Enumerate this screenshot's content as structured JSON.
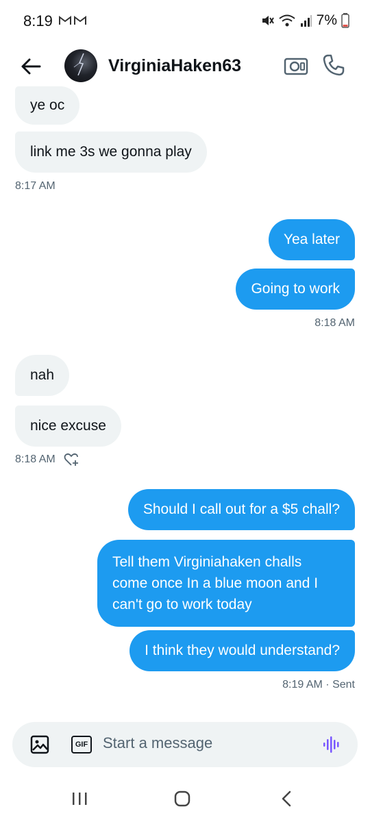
{
  "status_bar": {
    "time": "8:19",
    "battery": "7%"
  },
  "header": {
    "name": "VirginiaHaken63"
  },
  "messages": [
    {
      "text": "ye oc"
    },
    {
      "text": "link me 3s we gonna play"
    },
    {
      "text": "Yea later"
    },
    {
      "text": "Going to work"
    },
    {
      "text": "nah"
    },
    {
      "text": "nice excuse"
    },
    {
      "text": "Should I call out for a $5 chall?"
    },
    {
      "text_lines": [
        "Tell them Virginiahaken challs",
        "come once In a blue moon and I",
        "can't go to work today"
      ]
    },
    {
      "text": "I think they would understand?"
    }
  ],
  "timestamps": {
    "t1": "8:17 AM",
    "t2": "8:18 AM",
    "t3": "8:18 AM",
    "t4": "8:19 AM · Sent"
  },
  "composer": {
    "placeholder": "Start a message",
    "gif_label": "GIF"
  },
  "colors": {
    "outgoing_bubble": "#1d9bf0",
    "incoming_bubble": "#eff3f4",
    "voice_accent": "#7856ff"
  }
}
